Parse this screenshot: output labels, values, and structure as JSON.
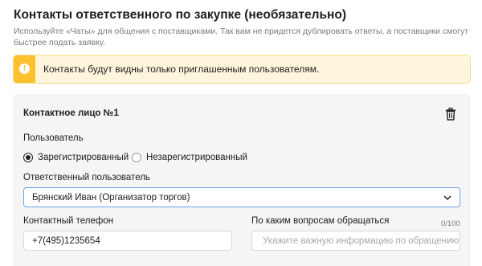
{
  "section": {
    "title": "Контакты ответственного по закупке (необязательно)",
    "subtitle": "Используйте «Чаты» для общения с поставщиками. Так вам не придется дублировать ответы, а поставщики смогут быстрее подать заявку."
  },
  "alert": {
    "icon": "exclamation-icon",
    "text": "Контакты будут видны только приглашенным пользователям.",
    "accent_color": "#fdc02f",
    "background_color": "#fdf6dc"
  },
  "contact_card": {
    "title": "Контактное лицо №1",
    "delete_icon": "trash-icon",
    "user_type": {
      "label": "Пользователь",
      "options": [
        {
          "label": "Зарегистрированный",
          "checked": true
        },
        {
          "label": "Незарегистрированный",
          "checked": false
        }
      ]
    },
    "responsible_user": {
      "label": "Ответственный пользователь",
      "value": "Брянский Иван (Организатор торгов)",
      "icon": "chevron-down-icon"
    },
    "phone": {
      "label": "Контактный телефон",
      "value": "+7(495)1235654"
    },
    "topics": {
      "label": "По каким вопросам обращаться",
      "counter": "0/100",
      "placeholder": "Укажите важную информацию по обращению"
    }
  }
}
